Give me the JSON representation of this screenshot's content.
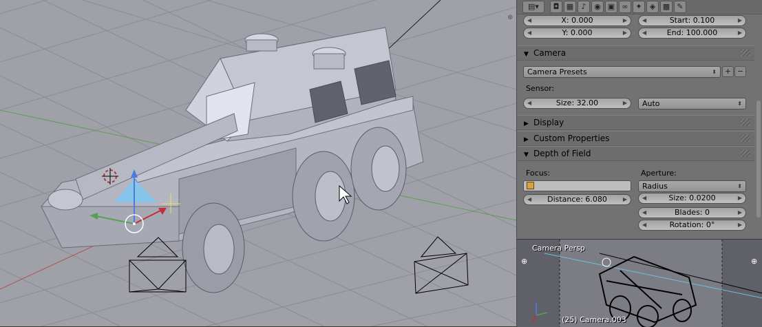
{
  "toolbar": {
    "icons": [
      "render-icon",
      "render-layers-icon",
      "scene-icon",
      "world-icon",
      "object-icon",
      "constraints-icon",
      "modifiers-icon",
      "data-camera-icon",
      "material-icon",
      "texture-icon"
    ]
  },
  "shift": {
    "x": "X: 0.000",
    "y": "Y: 0.000"
  },
  "clipping": {
    "start": "Start: 0.100",
    "end": "End: 100.000"
  },
  "camera_panel": {
    "title": "Camera",
    "presets": "Camera Presets",
    "sensor_label": "Sensor:",
    "size": "Size: 32.00",
    "fit": "Auto"
  },
  "display_panel": {
    "title": "Display"
  },
  "custom_panel": {
    "title": "Custom Properties"
  },
  "dof_panel": {
    "title": "Depth of Field",
    "focus_label": "Focus:",
    "distance": "Distance: 6.080",
    "aperture_label": "Aperture:",
    "aperture_type": "Radius",
    "size": "Size: 0.0200",
    "blades": "Blades: 0",
    "rotation": "Rotation: 0°"
  },
  "camera_view": {
    "label": "Camera Persp",
    "object": "(25) Camera.003"
  },
  "colors": {
    "viewport_bg": "#9fa0a8",
    "grid": "#8b8c95",
    "panel_bg": "#727272",
    "x_axis": "#b45050",
    "y_axis": "#5aa050",
    "manipulator_z": "#4a7ce0"
  }
}
